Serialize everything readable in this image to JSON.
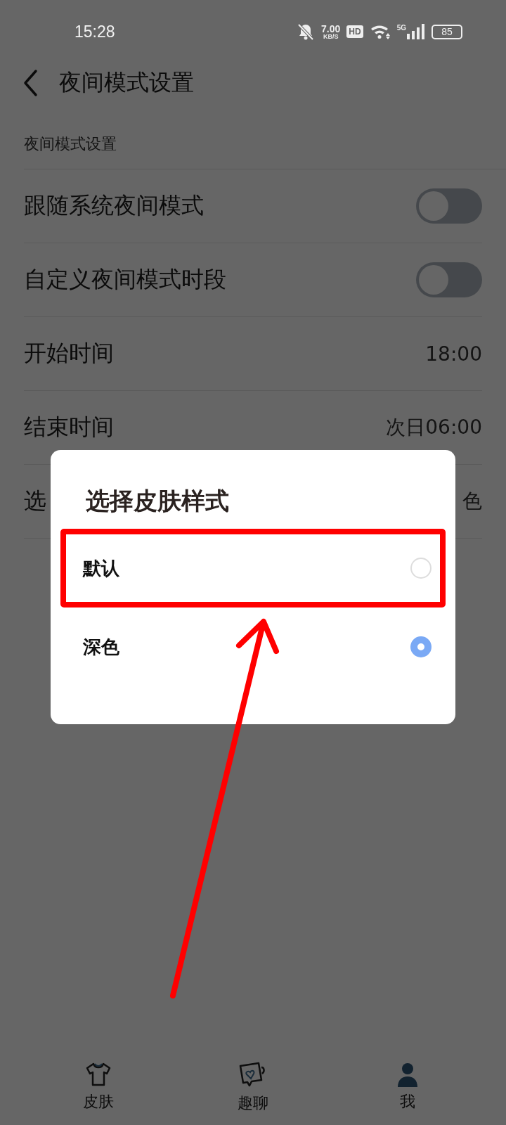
{
  "status_bar": {
    "time": "15:28",
    "net_speed": "7.00",
    "net_unit": "KB/S",
    "hd": "HD",
    "network": "5G",
    "battery": "85"
  },
  "header": {
    "title": "夜间模式设置"
  },
  "section_label": "夜间模式设置",
  "rows": [
    {
      "kind": "toggle",
      "label": "跟随系统夜间模式",
      "on": false
    },
    {
      "kind": "toggle",
      "label": "自定义夜间模式时段",
      "on": false
    },
    {
      "kind": "value",
      "label": "开始时间",
      "value": "18:00"
    },
    {
      "kind": "value",
      "label": "结束时间",
      "value": "次日06:00"
    },
    {
      "kind": "value",
      "label": "选",
      "value": "色"
    }
  ],
  "dialog": {
    "title": "选择皮肤样式",
    "options": [
      {
        "label": "默认",
        "selected": false,
        "highlighted": true
      },
      {
        "label": "深色",
        "selected": true,
        "highlighted": false
      }
    ]
  },
  "pointer_arrow": true,
  "nav": [
    {
      "kind": "shirt",
      "label": "皮肤"
    },
    {
      "kind": "chat",
      "label": "趣聊"
    },
    {
      "kind": "person",
      "label": "我"
    }
  ]
}
